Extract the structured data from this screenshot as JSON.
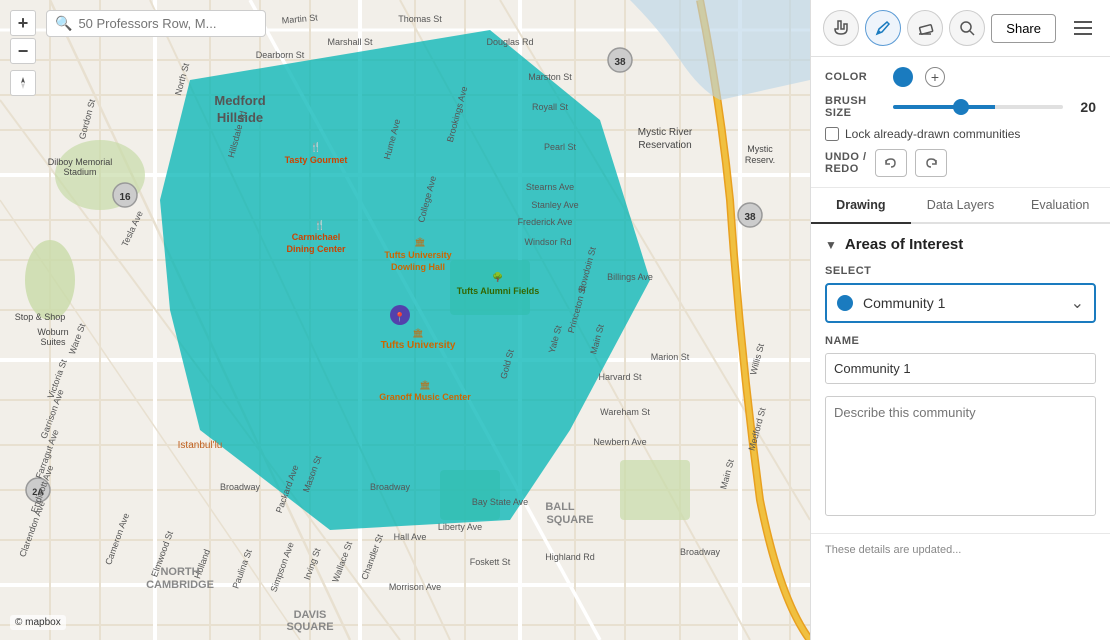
{
  "map": {
    "search_placeholder": "50 Professors Row, M...",
    "zoom_in": "+",
    "zoom_out": "−",
    "compass": "↑",
    "attribution": "© mapbox"
  },
  "toolbar": {
    "hand_tool_label": "hand",
    "pen_tool_label": "pen",
    "eraser_tool_label": "eraser",
    "search_tool_label": "search",
    "share_label": "Share",
    "menu_label": "menu"
  },
  "settings": {
    "color_label": "COLOR",
    "brush_label": "BRUSH\nSIZE",
    "brush_value": "20",
    "brush_value_num": 20,
    "lock_label": "Lock already-drawn communities",
    "lock_checked": false,
    "undo_label": "UNDO /\nRedo",
    "color_hex": "#1a7bbf"
  },
  "tabs": [
    {
      "id": "drawing",
      "label": "Drawing",
      "active": true
    },
    {
      "id": "data-layers",
      "label": "Data Layers",
      "active": false
    },
    {
      "id": "evaluation",
      "label": "Evaluation",
      "active": false
    }
  ],
  "aoi": {
    "title": "Areas of Interest",
    "toggle": "▼",
    "select_label": "SELECT",
    "community_name": "Community 1",
    "name_label": "NAME",
    "name_value": "Community 1",
    "desc_placeholder": "Describe this community",
    "bottom_note": "These details are updated..."
  }
}
